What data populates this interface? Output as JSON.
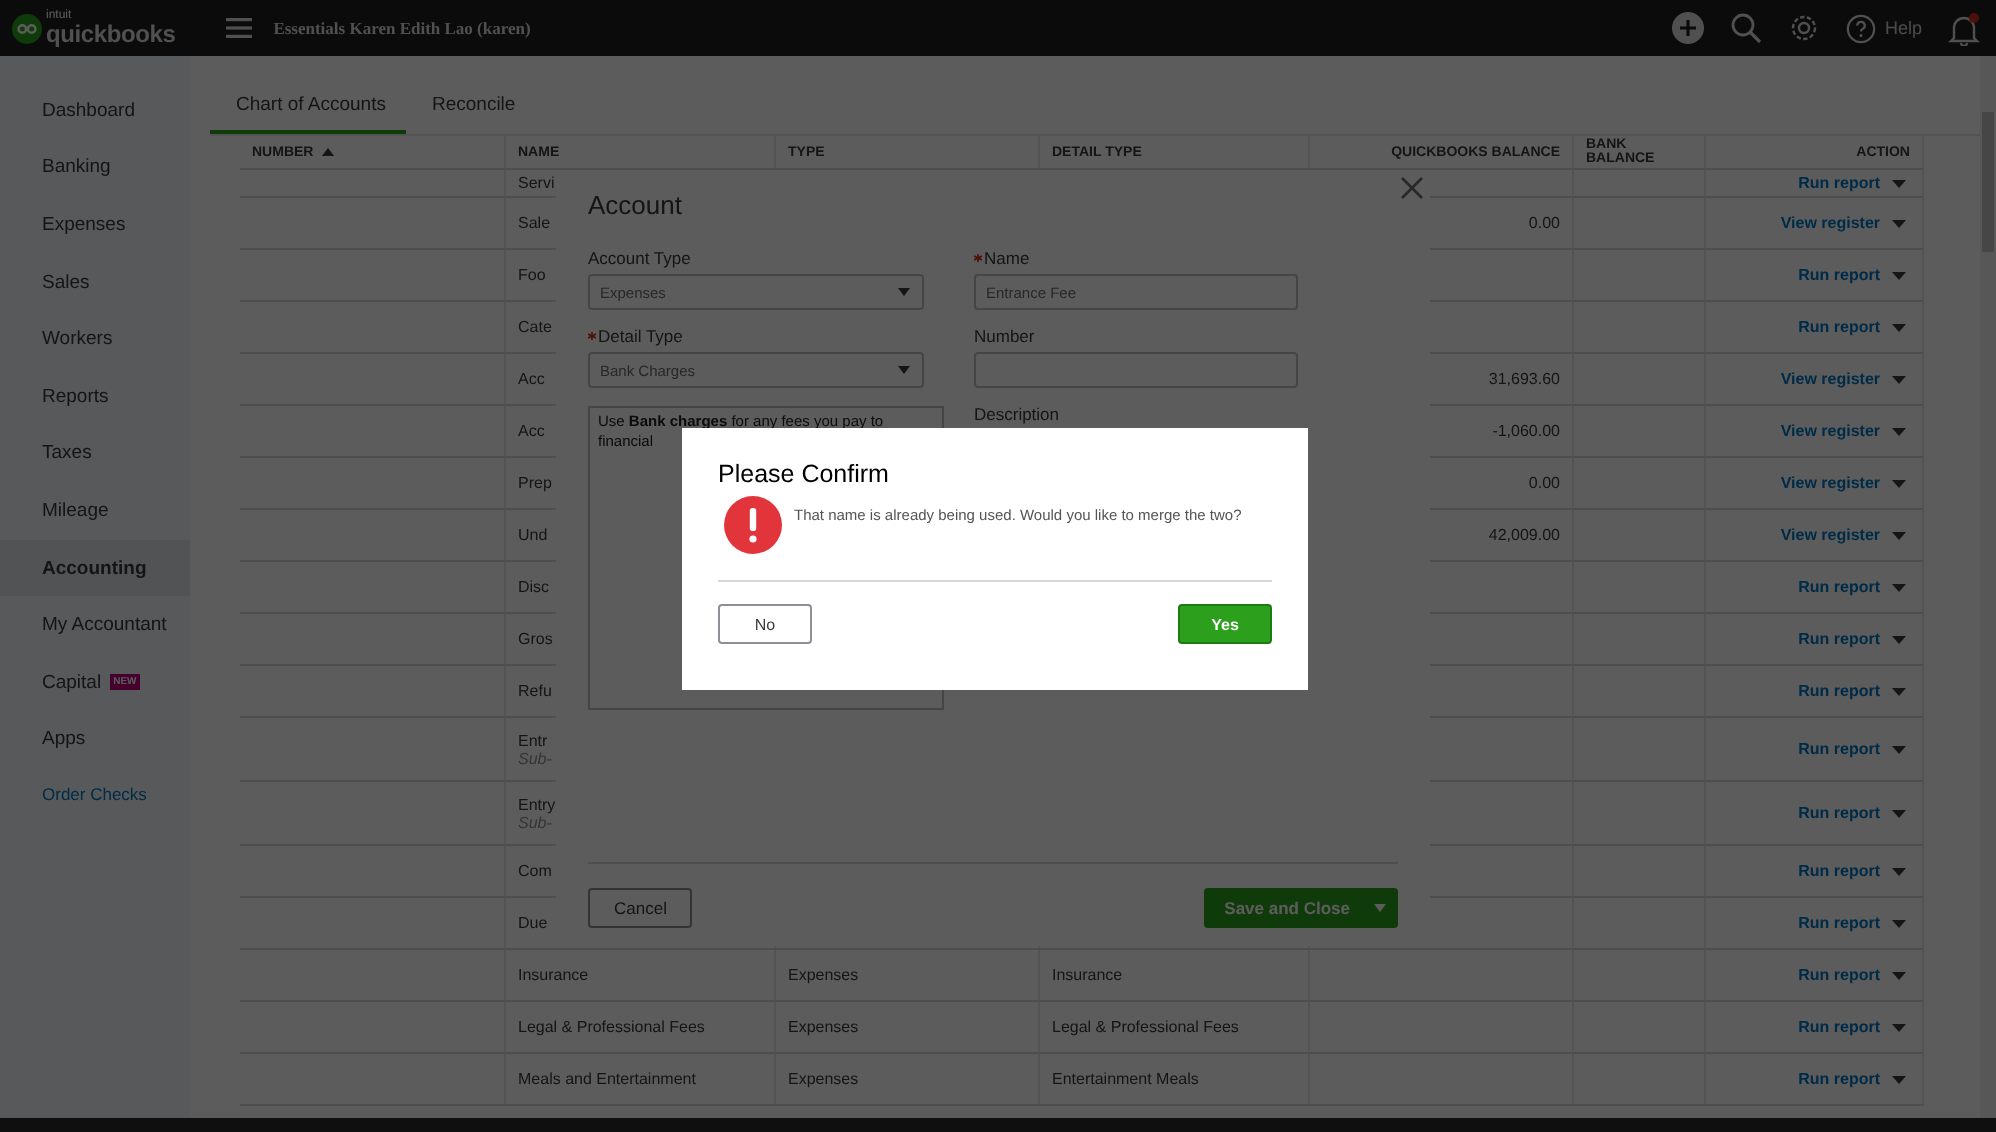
{
  "top_bar": {
    "brand_small": "intuit",
    "brand": "quickbooks",
    "company": "Essentials Karen Edith Lao (karen)",
    "help": "Help",
    "has_notification": true
  },
  "sidebar": {
    "items": [
      {
        "label": "Dashboard",
        "kind": "nav",
        "selected": false
      },
      {
        "label": "Banking",
        "kind": "nav",
        "selected": false
      },
      {
        "label": "Expenses",
        "kind": "nav",
        "selected": false
      },
      {
        "label": "Sales",
        "kind": "nav",
        "selected": false
      },
      {
        "label": "Workers",
        "kind": "nav",
        "selected": false
      },
      {
        "label": "Reports",
        "kind": "nav",
        "selected": false
      },
      {
        "label": "Taxes",
        "kind": "nav",
        "selected": false
      },
      {
        "label": "Mileage",
        "kind": "nav",
        "selected": false
      },
      {
        "label": "Accounting",
        "kind": "nav",
        "selected": true
      },
      {
        "label": "My Accountant",
        "kind": "nav",
        "selected": false
      },
      {
        "label": "Capital",
        "kind": "nav",
        "selected": false,
        "badge": "NEW"
      },
      {
        "label": "Apps",
        "kind": "nav",
        "selected": false
      },
      {
        "label": "Order Checks",
        "kind": "link",
        "selected": false
      }
    ]
  },
  "tabs": [
    {
      "label": "Chart of Accounts",
      "selected": true
    },
    {
      "label": "Reconcile",
      "selected": false
    }
  ],
  "table": {
    "columns": [
      {
        "label": "NUMBER",
        "sorted": true
      },
      {
        "label": "NAME",
        "sorted": false
      },
      {
        "label": "TYPE",
        "sorted": false
      },
      {
        "label": "DETAIL TYPE",
        "sorted": false
      },
      {
        "label": "QUICKBOOKS BALANCE",
        "sorted": false
      },
      {
        "label": "BANK BALANCE",
        "sorted": false
      },
      {
        "label": "ACTION",
        "sorted": false
      }
    ],
    "rows": [
      {
        "name": "Servi",
        "action": "Run report",
        "short": true
      },
      {
        "name": "Sale",
        "qb_balance": "0.00",
        "action": "View register"
      },
      {
        "name": "Foo",
        "action": "Run report"
      },
      {
        "name": "Cate",
        "action": "Run report"
      },
      {
        "name": "Acc",
        "qb_balance": "31,693.60",
        "action": "View register"
      },
      {
        "name": "Acc",
        "qb_balance": "-1,060.00",
        "action": "View register"
      },
      {
        "name": "Prep",
        "qb_balance": "0.00",
        "action": "View register"
      },
      {
        "name": "Und",
        "qb_balance": "42,009.00",
        "action": "View register"
      },
      {
        "name": "Disc",
        "action": "Run report"
      },
      {
        "name": "Gros",
        "action": "Run report"
      },
      {
        "name": "Refu",
        "action": "Run report"
      },
      {
        "name": "Entr",
        "sub": "Sub-",
        "action": "Run report"
      },
      {
        "name": "Entry",
        "sub": "Sub-",
        "action": "Run report"
      },
      {
        "name": "Com",
        "action": "Run report"
      },
      {
        "name": "Due",
        "action": "Run report"
      },
      {
        "name": "Insurance",
        "type": "Expenses",
        "detail_type": "Insurance",
        "action": "Run report"
      },
      {
        "name": "Legal & Professional Fees",
        "type": "Expenses",
        "detail_type": "Legal & Professional Fees",
        "action": "Run report"
      },
      {
        "name": "Meals and Entertainment",
        "type": "Expenses",
        "detail_type": "Entertainment Meals",
        "action": "Run report"
      }
    ]
  },
  "account_modal": {
    "title": "Account",
    "left_fields": [
      {
        "label": "Account Type",
        "value": "Expenses",
        "required": false
      },
      {
        "label": "Detail Type",
        "value": "Bank Charges",
        "required": true
      }
    ],
    "detail_help": "Use **Bank charges** for any fees you pay to financial",
    "right_fields": [
      {
        "label": "Name",
        "value": "Entrance Fee",
        "required": true
      },
      {
        "label": "Number",
        "required": false
      }
    ],
    "description_label": "Description",
    "cancel": "Cancel",
    "save": "Save and Close"
  },
  "confirm_dialog": {
    "title": "Please Confirm",
    "message": "That name is already being used. Would you like to merge the two?",
    "no": "No",
    "yes": "Yes"
  }
}
